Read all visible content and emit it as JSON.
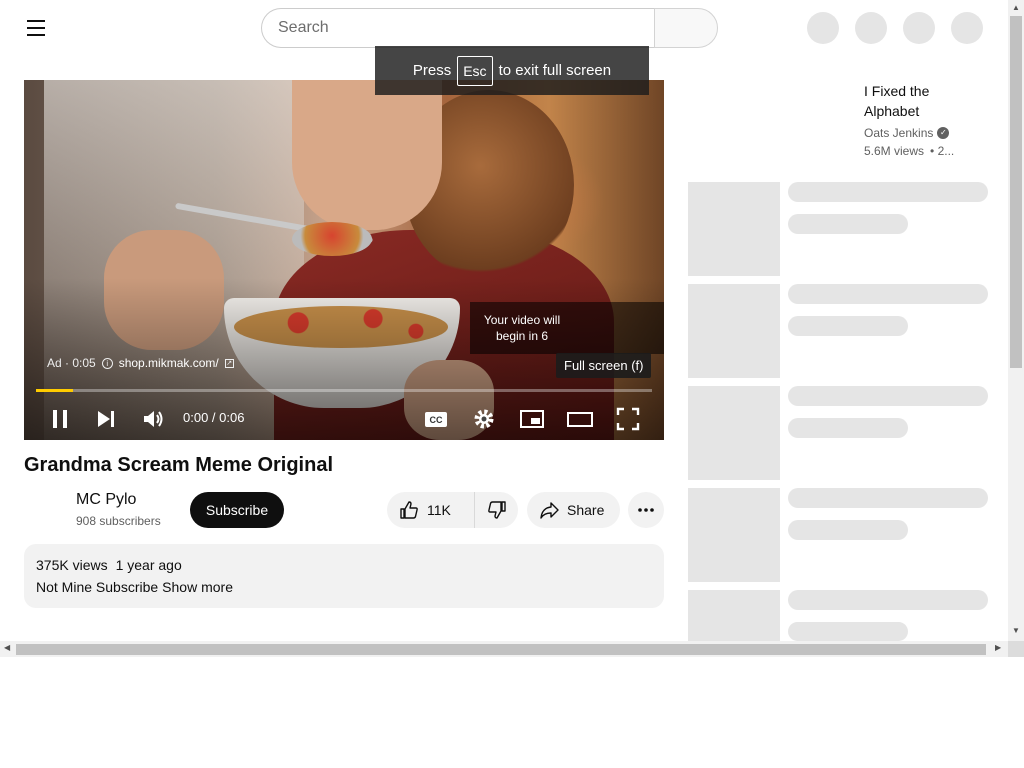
{
  "header": {
    "search_placeholder": "Search"
  },
  "fullscreen_toast": {
    "press": "Press",
    "key": "Esc",
    "rest": "to exit full screen"
  },
  "player": {
    "ad_label": "Ad · 0:05",
    "ad_url": "shop.mikmak.com/",
    "skip_text": "Your video will begin in 6",
    "tooltip": "Full screen (f)",
    "time": "0:00 / 0:06",
    "progress_fraction": 0.06,
    "cc_label": "CC",
    "accent_color": "#ffcc00"
  },
  "video": {
    "title": "Grandma Scream Meme Original",
    "channel": "MC Pylo",
    "subscribers": "908 subscribers",
    "subscribe_label": "Subscribe",
    "likes": "11K",
    "share_label": "Share"
  },
  "description": {
    "views": "375K views",
    "age": "1 year ago",
    "text": "Not Mine Subscribe",
    "show_more": "Show more"
  },
  "sidebar": {
    "recommended": {
      "title": "I Fixed the Alphabet",
      "channel": "Oats Jenkins",
      "views": "5.6M views",
      "age": "• 2..."
    }
  },
  "icons": {
    "menu": "hamburger-icon",
    "pause": "pause-icon",
    "next": "next-icon",
    "volume": "volume-icon",
    "cc": "captions-icon",
    "settings": "gear-icon",
    "miniplayer": "miniplayer-icon",
    "theater": "theater-icon",
    "fullscreen": "fullscreen-icon",
    "like": "thumbs-up-icon",
    "dislike": "thumbs-down-icon",
    "share": "share-icon",
    "more": "more-dots-icon",
    "verified": "verified-check-icon"
  }
}
